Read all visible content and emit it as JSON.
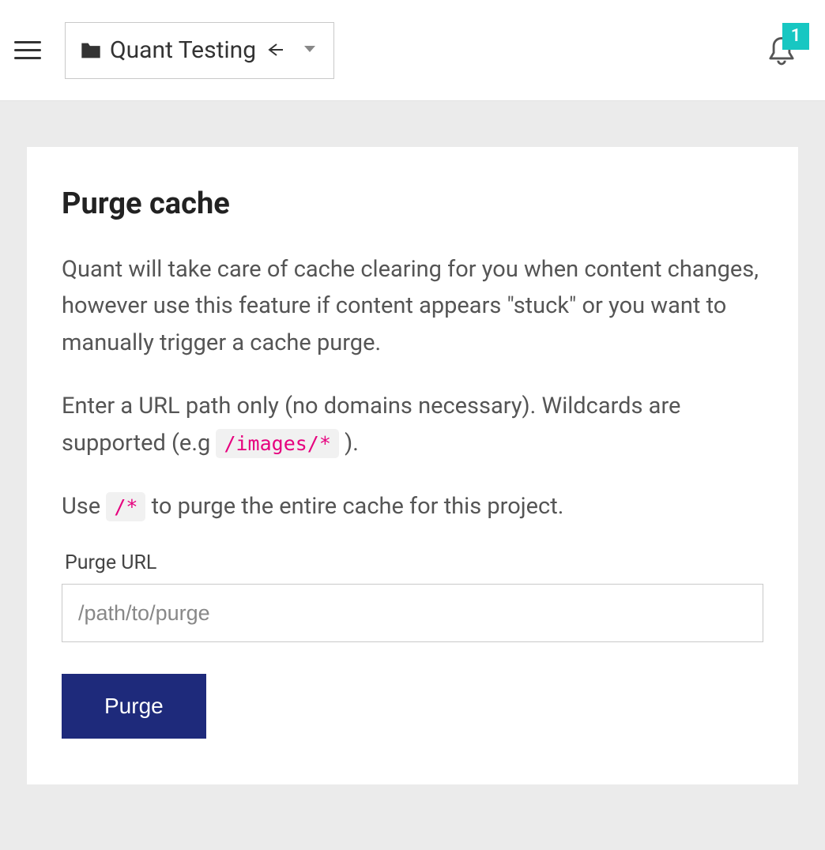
{
  "header": {
    "project_name": "Quant Testing",
    "notification_count": "1"
  },
  "main": {
    "title": "Purge cache",
    "desc1": "Quant will take care of cache clearing for you when content changes, however use this feature if content appears \"stuck\" or you want to manually trigger a cache purge.",
    "desc2_prefix": "Enter a URL path only (no domains necessary). Wildcards are supported (e.g ",
    "desc2_code": "/images/*",
    "desc2_suffix": " ).",
    "desc3_prefix": "Use ",
    "desc3_code": "/*",
    "desc3_suffix": " to purge the entire cache for this project.",
    "field_label": "Purge URL",
    "field_placeholder": "/path/to/purge",
    "button_label": "Purge"
  }
}
